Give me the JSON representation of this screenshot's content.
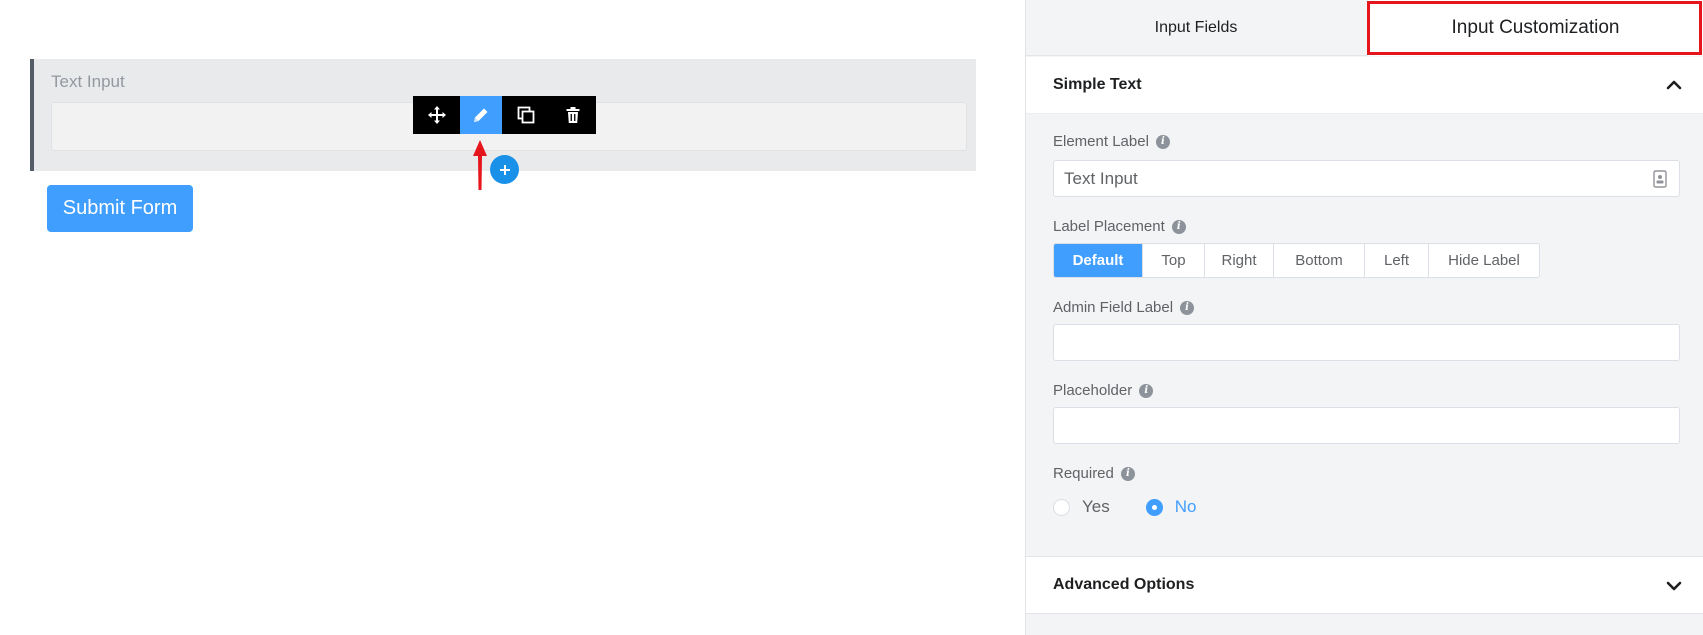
{
  "canvas": {
    "field": {
      "label": "Text Input"
    },
    "toolbar": [
      {
        "name": "move",
        "icon": "move-icon"
      },
      {
        "name": "edit",
        "icon": "pencil-icon",
        "active": true
      },
      {
        "name": "duplicate",
        "icon": "copy-icon"
      },
      {
        "name": "delete",
        "icon": "trash-icon"
      }
    ],
    "add_icon": "plus-icon",
    "submit_label": "Submit Form"
  },
  "panel": {
    "tabs": [
      {
        "label": "Input Fields",
        "active": false
      },
      {
        "label": "Input Customization",
        "active": true
      }
    ],
    "section": {
      "title": "Simple Text",
      "element_label": {
        "label": "Element Label",
        "value": "Text Input"
      },
      "label_placement": {
        "label": "Label Placement",
        "options": [
          "Default",
          "Top",
          "Right",
          "Bottom",
          "Left",
          "Hide Label"
        ],
        "selected": "Default"
      },
      "admin_field_label": {
        "label": "Admin Field Label",
        "value": ""
      },
      "placeholder": {
        "label": "Placeholder",
        "value": ""
      },
      "required": {
        "label": "Required",
        "options": [
          "Yes",
          "No"
        ],
        "selected": "No"
      }
    },
    "advanced": {
      "title": "Advanced Options"
    }
  },
  "colors": {
    "primary": "#409eff",
    "highlight": "#e6141b",
    "toolbar": "#000000"
  }
}
